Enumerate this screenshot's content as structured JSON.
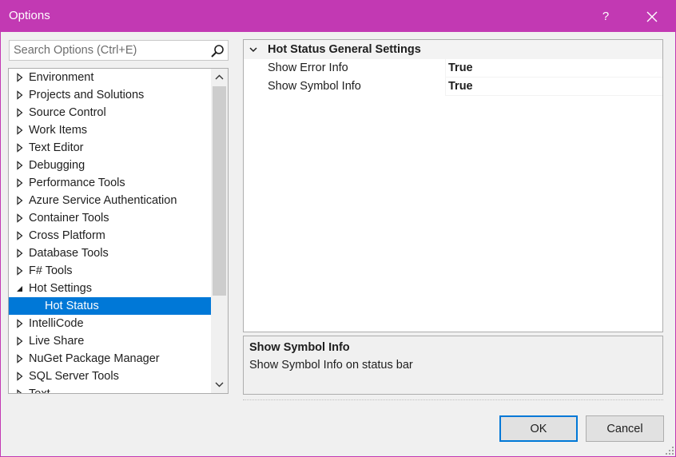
{
  "window": {
    "title": "Options",
    "help_label": "?",
    "accent": "#c239b3"
  },
  "search": {
    "placeholder": "Search Options (Ctrl+E)",
    "value": ""
  },
  "tree": {
    "items": [
      {
        "label": "Environment",
        "expanded": false
      },
      {
        "label": "Projects and Solutions",
        "expanded": false
      },
      {
        "label": "Source Control",
        "expanded": false
      },
      {
        "label": "Work Items",
        "expanded": false
      },
      {
        "label": "Text Editor",
        "expanded": false
      },
      {
        "label": "Debugging",
        "expanded": false
      },
      {
        "label": "Performance Tools",
        "expanded": false
      },
      {
        "label": "Azure Service Authentication",
        "expanded": false
      },
      {
        "label": "Container Tools",
        "expanded": false
      },
      {
        "label": "Cross Platform",
        "expanded": false
      },
      {
        "label": "Database Tools",
        "expanded": false
      },
      {
        "label": "F# Tools",
        "expanded": false
      },
      {
        "label": "Hot Settings",
        "expanded": true
      },
      {
        "label": "Hot Status",
        "child": true,
        "selected": true
      },
      {
        "label": "IntelliCode",
        "expanded": false
      },
      {
        "label": "Live Share",
        "expanded": false
      },
      {
        "label": "NuGet Package Manager",
        "expanded": false
      },
      {
        "label": "SQL Server Tools",
        "expanded": false
      },
      {
        "label": "Text",
        "expanded": false
      }
    ]
  },
  "grid": {
    "category": "Hot Status General Settings",
    "rows": [
      {
        "name": "Show Error Info",
        "value": "True"
      },
      {
        "name": "Show Symbol Info",
        "value": "True"
      }
    ]
  },
  "description": {
    "title": "Show Symbol Info",
    "text": "Show Symbol Info on status bar"
  },
  "buttons": {
    "ok": "OK",
    "cancel": "Cancel"
  },
  "colors": {
    "selection": "#0078d7",
    "title_bar": "#c239b3"
  }
}
